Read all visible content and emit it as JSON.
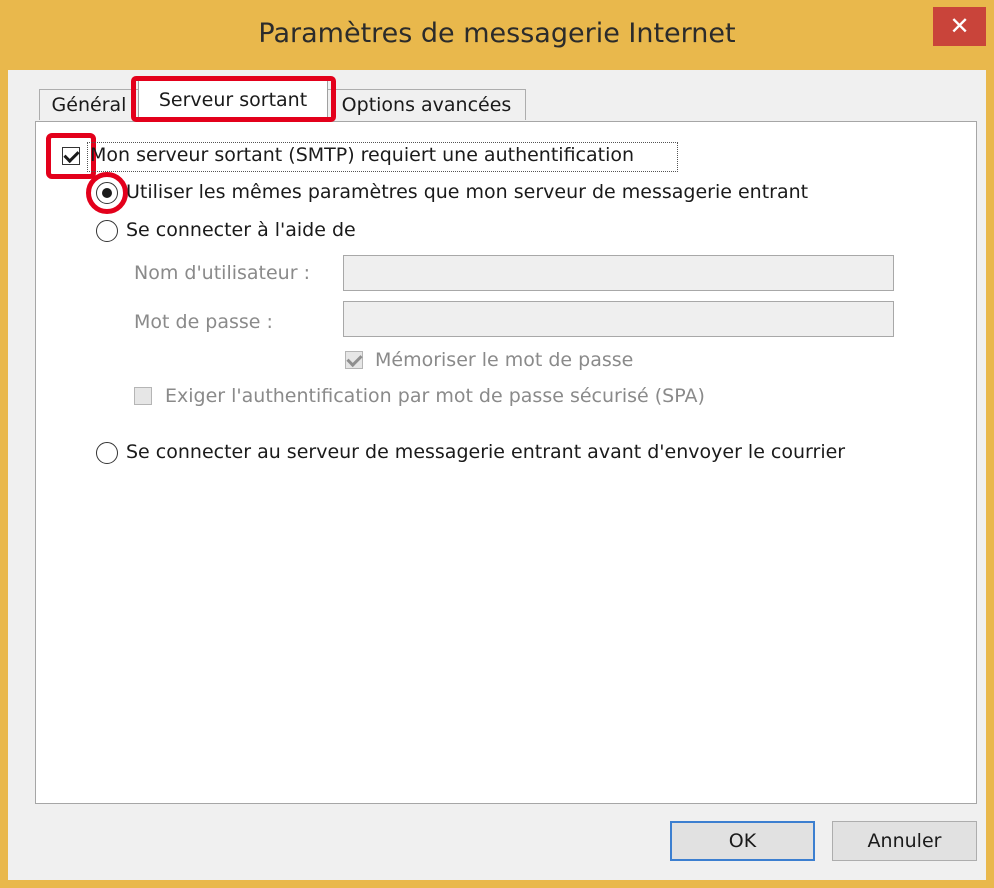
{
  "window": {
    "title": "Paramètres de messagerie Internet",
    "close_glyph": "✕"
  },
  "tabs": [
    {
      "label": "Général"
    },
    {
      "label": "Serveur sortant"
    },
    {
      "label": "Options avancées"
    }
  ],
  "auth": {
    "smtp_requires_auth_label": "Mon serveur sortant (SMTP) requiert une authentification",
    "smtp_requires_auth_checked": true,
    "same_settings_label": "Utiliser les mêmes paramètres que mon serveur de messagerie entrant",
    "connect_with_label": "Se connecter à l'aide de",
    "username_label": "Nom d'utilisateur :",
    "username_value": "",
    "password_label": "Mot de passe :",
    "password_value": "",
    "remember_password_label": "Mémoriser le mot de passe",
    "remember_password_checked": true,
    "spa_label": "Exiger l'authentification par mot de passe sécurisé (SPA)",
    "spa_checked": false,
    "connect_incoming_first_label": "Se connecter au serveur de messagerie entrant avant d'envoyer le courrier",
    "selected_option": "same_settings"
  },
  "buttons": {
    "ok": "OK",
    "cancel": "Annuler"
  },
  "colors": {
    "title_bar": "#e9b84c",
    "close": "#c9443a",
    "highlight": "#e3001b",
    "default_button_border": "#3c7fd0"
  }
}
